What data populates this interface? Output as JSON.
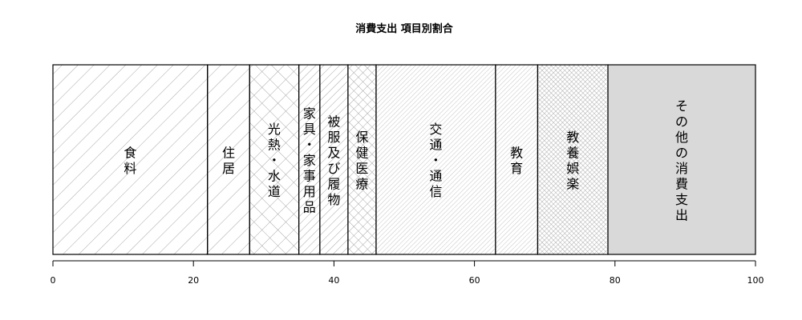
{
  "chart_data": {
    "type": "bar",
    "orientation": "horizontal-stacked",
    "title": "消費支出 項目別割合",
    "xlim": [
      0,
      100
    ],
    "ticks": [
      0,
      20,
      40,
      60,
      80,
      100
    ],
    "grid": false,
    "categories": [
      "食料",
      "住居",
      "光熱・水道",
      "家具・家事用品",
      "被服及び履物",
      "保健医療",
      "交通・通信",
      "教育",
      "教養娯楽",
      "その他の消費支出"
    ],
    "values": [
      22,
      6,
      7,
      3,
      4,
      4,
      17,
      6,
      10,
      21
    ],
    "label_lines": [
      [
        "食",
        "料"
      ],
      [
        "住",
        "居"
      ],
      [
        "光",
        "熱",
        "・",
        "水",
        "道"
      ],
      [
        "家",
        "具",
        "・",
        "家",
        "事",
        "用",
        "品"
      ],
      [
        "被",
        "服",
        "及",
        "び",
        "履",
        "物"
      ],
      [
        "保",
        "健",
        "医",
        "療"
      ],
      [
        "交",
        "通",
        "・",
        "通",
        "信"
      ],
      [
        "教",
        "育"
      ],
      [
        "教",
        "養",
        "娯",
        "楽"
      ],
      [
        "そ",
        "の",
        "他",
        "の",
        "消",
        "費",
        "支",
        "出"
      ]
    ],
    "fills": [
      "diag-wide",
      "diag-wide",
      "cross-wide",
      "diag-narrow",
      "diag-narrow",
      "cross-narrow",
      "diag-fine",
      "diag-fine",
      "cross-fine",
      "solid-gray"
    ],
    "colors": {
      "stroke": "#000000",
      "hatch": "#a8a8a8",
      "solid": "#d9d9d9"
    }
  }
}
